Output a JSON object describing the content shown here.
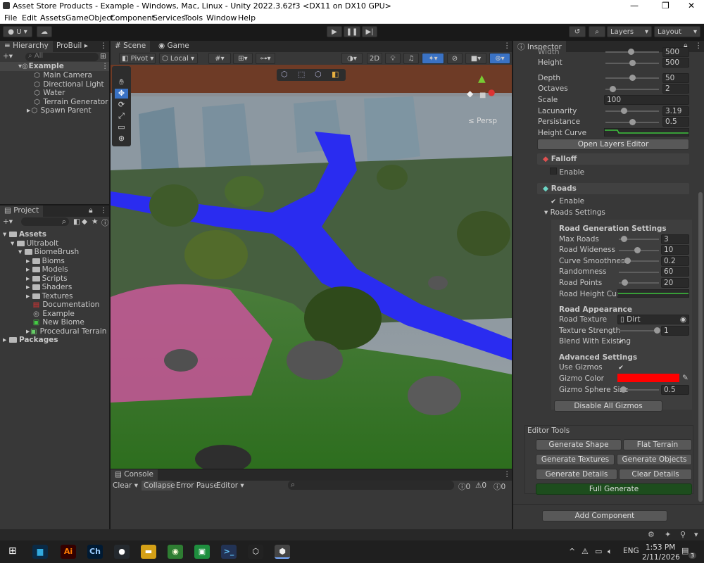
{
  "window": {
    "title": "Asset Store Products - Example - Windows, Mac, Linux - Unity 2022.3.62f3 <DX11 on DX10 GPU>"
  },
  "menu": [
    "File",
    "Edit",
    "Assets",
    "GameObject",
    "Component",
    "Services",
    "Tools",
    "Window",
    "Help"
  ],
  "toolbar": {
    "account": "U",
    "layers": "Layers",
    "layout": "Layout"
  },
  "hierarchy": {
    "tab": "Hierarchy",
    "tab2": "ProBuil",
    "search_placeholder": "All",
    "root": "Example",
    "items": [
      "Main Camera",
      "Directional Light",
      "Water",
      "Terrain Generator",
      "Spawn Parent"
    ]
  },
  "project": {
    "tab": "Project",
    "assets": "Assets",
    "ultrabolt": "Ultrabolt",
    "biomebrush": "BiomeBrush",
    "folders": [
      "Bioms",
      "Models",
      "Scripts",
      "Shaders",
      "Textures"
    ],
    "files": [
      "Documentation",
      "Example",
      "New Biome",
      "Procedural Terrain"
    ],
    "packages": "Packages",
    "count": "13"
  },
  "scene": {
    "tab": "Scene",
    "game_tab": "Game",
    "pivot": "Pivot",
    "local": "Local",
    "mode2d": "2D",
    "persp": "Persp"
  },
  "console": {
    "tab": "Console",
    "clear": "Clear",
    "collapse": "Collapse",
    "error_pause": "Error Pause",
    "editor": "Editor",
    "counts": [
      "0",
      "0",
      "0"
    ]
  },
  "inspector": {
    "tab": "Inspector",
    "width_label": "Width",
    "width_value": "500",
    "height_label": "Height",
    "height_value": "500",
    "depth_label": "Depth",
    "depth_value": "50",
    "octaves_label": "Octaves",
    "octaves_value": "2",
    "scale_label": "Scale",
    "scale_value": "100",
    "lacunarity_label": "Lacunarity",
    "lacunarity_value": "3.19",
    "persistance_label": "Persistance",
    "persistance_value": "0.5",
    "height_curve_label": "Height Curve",
    "open_layers_editor": "Open Layers Editor",
    "falloff_header": "Falloff",
    "falloff_enable": "Enable",
    "roads_header": "Roads",
    "roads_enable": "Enable",
    "roads_settings": "Roads Settings",
    "road_gen_header": "Road Generation Settings",
    "max_roads_label": "Max Roads",
    "max_roads_value": "3",
    "road_wideness_label": "Road Wideness",
    "road_wideness_value": "10",
    "curve_smoothness_label": "Curve Smoothness",
    "curve_smoothness_value": "0.2",
    "randomness_label": "Randomness",
    "randomness_value": "60",
    "road_points_label": "Road Points",
    "road_points_value": "20",
    "road_height_curve_label": "Road Height Curve",
    "road_appearance_header": "Road Appearance",
    "road_texture_label": "Road Texture",
    "road_texture_value": "Dirt",
    "texture_strength_label": "Texture Strength",
    "texture_strength_value": "1",
    "blend_label": "Blend With Existing",
    "advanced_header": "Advanced Settings",
    "use_gizmos_label": "Use Gizmos",
    "gizmo_color_label": "Gizmo Color",
    "gizmo_color": "#ff0000",
    "gizmo_sphere_label": "Gizmo Sphere Size",
    "gizmo_sphere_value": "0.5",
    "disable_gizmos": "Disable All Gizmos",
    "editor_tools_header": "Editor Tools",
    "generate_shape": "Generate Shape",
    "flat_terrain": "Flat Terrain",
    "generate_textures": "Generate Textures",
    "generate_objects": "Generate Objects",
    "generate_details": "Generate Details",
    "clear_details": "Clear Details",
    "full_generate": "Full Generate",
    "add_component": "Add Component"
  },
  "taskbar": {
    "time": "1:53 PM",
    "date": "2/11/2026",
    "lang": "ENG",
    "notif": "3",
    "apps": [
      "Ai",
      "Ch"
    ]
  },
  "colors": {
    "accent": "#3a72c4",
    "full_generate": "#1d4d1d",
    "water": "#2a2cf0",
    "grass": "#3e8a2c"
  }
}
